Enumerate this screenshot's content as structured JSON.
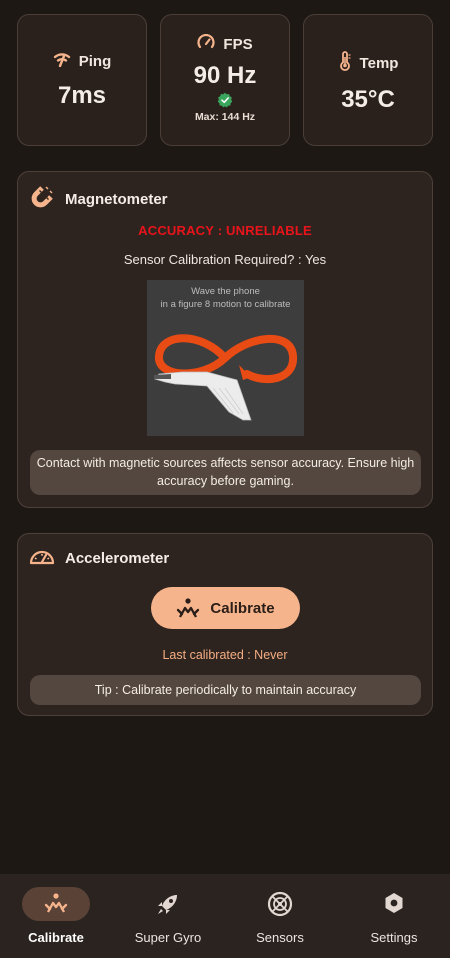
{
  "stats": {
    "ping": {
      "label": "Ping",
      "value": "7ms",
      "icon": "signal-icon"
    },
    "fps": {
      "label": "FPS",
      "value": "90 Hz",
      "max": "Max: 144 Hz",
      "icon": "speedometer-icon"
    },
    "temp": {
      "label": "Temp",
      "value": "35°C",
      "icon": "thermometer-icon"
    }
  },
  "magnetometer": {
    "title": "Magnetometer",
    "accuracy": "ACCURACY : UNRELIABLE",
    "calibration_required": "Sensor Calibration Required? : Yes",
    "illustration_text_1": "Wave the phone",
    "illustration_text_2": "in a figure 8 motion to calibrate",
    "notice": "Contact with magnetic sources affects sensor accuracy. Ensure high accuracy before gaming."
  },
  "accelerometer": {
    "title": "Accelerometer",
    "button_label": "Calibrate",
    "last_calibrated": "Last calibrated : Never",
    "tip": "Tip : Calibrate periodically to maintain accuracy"
  },
  "nav": {
    "items": [
      {
        "label": "Calibrate",
        "icon": "calibrate-icon",
        "active": true
      },
      {
        "label": "Super Gyro",
        "icon": "rocket-icon",
        "active": false
      },
      {
        "label": "Sensors",
        "icon": "sensors-icon",
        "active": false
      },
      {
        "label": "Settings",
        "icon": "settings-hexagon-icon",
        "active": false
      }
    ]
  },
  "colors": {
    "accent": "#f6b48c",
    "warning": "#e8141b",
    "verified": "#3aa55d",
    "background": "#1e1815"
  }
}
